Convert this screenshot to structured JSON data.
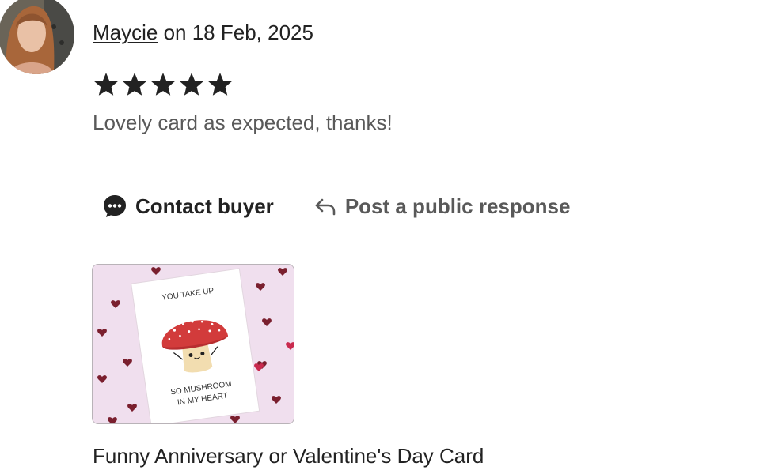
{
  "review": {
    "author": "Maycie",
    "date_text": " on 18 Feb, 2025",
    "rating": 5,
    "rating_max": 5,
    "text": "Lovely card as expected, thanks!"
  },
  "actions": {
    "contact_label": "Contact buyer",
    "respond_label": "Post a public response"
  },
  "listing": {
    "title": "Funny Anniversary or Valentine's Day Card",
    "image_text_top": "YOU TAKE UP",
    "image_text_bottom_1": "SO MUSHROOM",
    "image_text_bottom_2": "IN MY HEART"
  },
  "colors": {
    "text": "#222222",
    "muted": "#595959",
    "card_bg": "#f0dfee",
    "mushroom_cap": "#d23b3b",
    "heart": "#7a1f2e"
  },
  "icons": {
    "star": "star-icon",
    "contact": "chat-bubble-icon",
    "respond": "reply-arrow-icon"
  }
}
